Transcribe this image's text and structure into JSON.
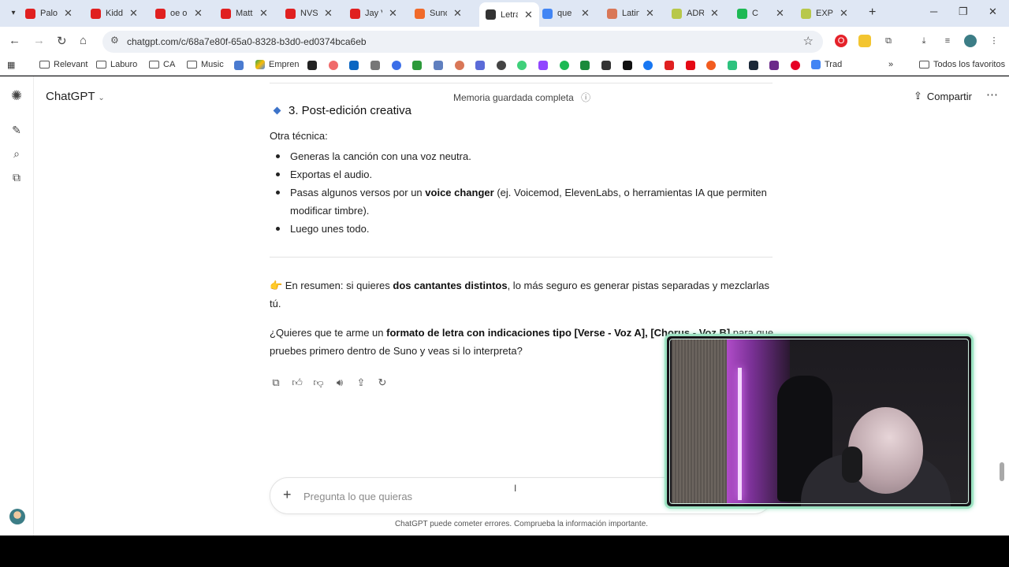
{
  "tabs": [
    {
      "label": "Palon",
      "color": "#e02020"
    },
    {
      "label": "Kidd",
      "color": "#e02020"
    },
    {
      "label": "oe o",
      "color": "#e02020"
    },
    {
      "label": "Matt",
      "color": "#e02020"
    },
    {
      "label": "NVSI",
      "color": "#e02020"
    },
    {
      "label": "Jay V",
      "color": "#e02020"
    },
    {
      "label": "Suno",
      "color": "#f06a2a"
    },
    {
      "label": "Letra",
      "color": "#333333",
      "active": true
    },
    {
      "label": "que",
      "color": "#4285f4"
    },
    {
      "label": "Latin",
      "color": "#d97757"
    },
    {
      "label": "ADRI",
      "color": "#b8c84a"
    },
    {
      "label": "C",
      "color": "#1db954"
    },
    {
      "label": "EXPL",
      "color": "#b8c84a"
    }
  ],
  "browser": {
    "url": "chatgpt.com/c/68a7e80f-65a0-8328-b3d0-ed0374bca6eb"
  },
  "bookmarks": {
    "items": [
      {
        "label": "Relevant"
      },
      {
        "label": "Laburo"
      },
      {
        "label": "CA"
      },
      {
        "label": "Music"
      },
      {
        "label": "Empren"
      }
    ],
    "trad": "Trad",
    "all_favorites": "Todos los favoritos"
  },
  "app": {
    "title": "ChatGPT",
    "memory_status": "Memoria guardada completa",
    "share_label": "Compartir"
  },
  "message": {
    "heading": "3. Post-edición creativa",
    "intro": "Otra técnica:",
    "steps": [
      {
        "pre": "Generas la canción con una voz neutra.",
        "bold": "",
        "post": ""
      },
      {
        "pre": "Exportas el audio.",
        "bold": "",
        "post": ""
      },
      {
        "pre": "Pasas algunos versos por un ",
        "bold": "voice changer",
        "post": " (ej. Voicemod, ElevenLabs, o herramientas IA que permiten modificar timbre)."
      },
      {
        "pre": "Luego unes todo.",
        "bold": "",
        "post": ""
      }
    ],
    "summary_emoji": "👉",
    "summary_pre": " En resumen: si quieres ",
    "summary_bold": "dos cantantes distintos",
    "summary_post": ", lo más seguro es generar pistas separadas y mezclarlas tú.",
    "question_pre": "¿Quieres que te arme un ",
    "question_bold": "formato de letra con indicaciones tipo [Verse - Voz A], [Chorus - Voz B]",
    "question_post": " para que pruebes primero dentro de Suno y veas si lo interpreta?"
  },
  "composer": {
    "placeholder": "Pregunta lo que quieras"
  },
  "disclaimer": "ChatGPT puede cometer errores. Comprueba la información importante."
}
